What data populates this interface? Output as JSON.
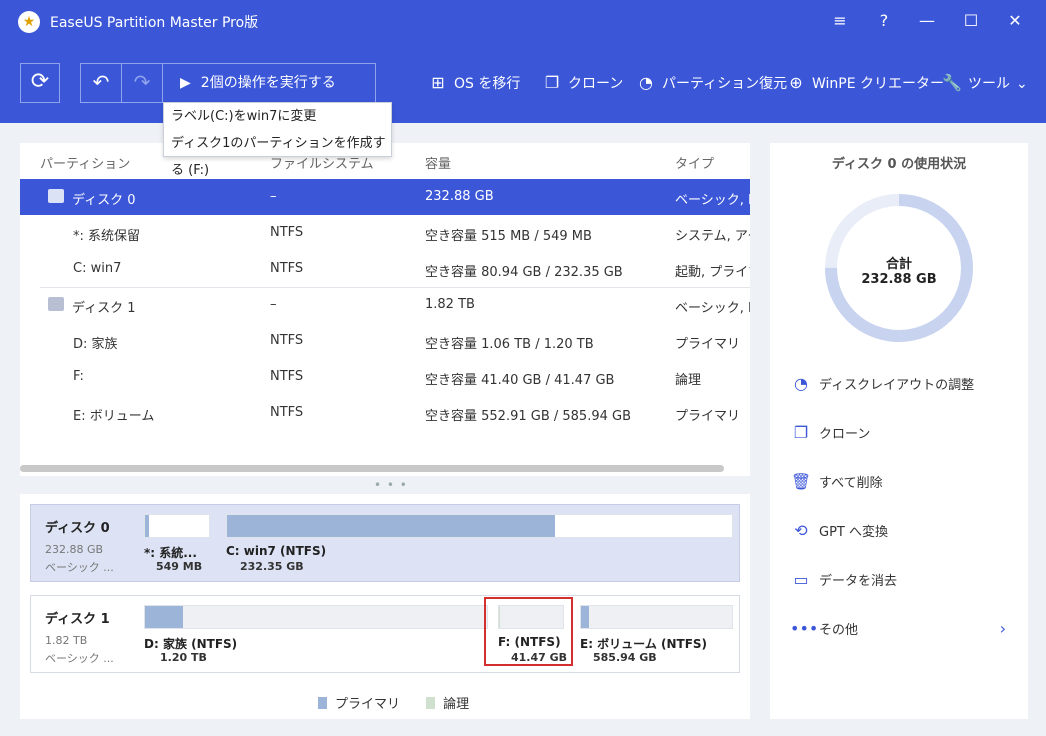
{
  "app": {
    "title": "EaseUS Partition Master Pro版"
  },
  "toolbar": {
    "execute_label": "2個の操作を実行する",
    "tools": [
      {
        "icon": "windows-icon",
        "label": "OS を移行"
      },
      {
        "icon": "clone-icon",
        "label": "クローン"
      },
      {
        "icon": "pie-icon",
        "label": "パーティション復元"
      },
      {
        "icon": "plus-circle-icon",
        "label": "WinPE クリエーター"
      },
      {
        "icon": "wrench-icon",
        "label": "ツール"
      }
    ]
  },
  "pending_ops": [
    "ラベル(C:)をwin7に変更",
    "ディスク1のパーティションを作成する (F:)"
  ],
  "table": {
    "headers": [
      "パーティション",
      "ファイルシステム",
      "容量",
      "タイプ"
    ],
    "rows": [
      {
        "name": "ディスク 0",
        "fs": "–",
        "capacity": "232.88 GB",
        "type": "ベーシック, MB"
      },
      {
        "name": "*: 系统保留",
        "fs": "NTFS",
        "capacity": "空き容量 515 MB / 549 MB",
        "type": "システム, アクテ"
      },
      {
        "name": "C: win7",
        "fs": "NTFS",
        "capacity": "空き容量 80.94 GB / 232.35 GB",
        "type": "起動, プライマ"
      },
      {
        "name": "ディスク 1",
        "fs": "–",
        "capacity": "1.82 TB",
        "type": "ベーシック, MB"
      },
      {
        "name": "D: 家族",
        "fs": "NTFS",
        "capacity": "空き容量 1.06 TB / 1.20 TB",
        "type": "プライマリ"
      },
      {
        "name": "F:",
        "fs": "NTFS",
        "capacity": "空き容量 41.40 GB / 41.47 GB",
        "type": "論理"
      },
      {
        "name": "E: ボリューム",
        "fs": "NTFS",
        "capacity": "空き容量 552.91 GB / 585.94 GB",
        "type": "プライマリ"
      }
    ]
  },
  "disk_map": [
    {
      "name": "ディスク 0",
      "size": "232.88 GB",
      "type": "ベーシック ...",
      "partitions": [
        {
          "name": "*: 系統...",
          "size": "549 MB",
          "used_fraction": 0.06
        },
        {
          "name": "C: win7 (NTFS)",
          "size": "232.35 GB",
          "used_fraction": 0.65
        }
      ]
    },
    {
      "name": "ディスク 1",
      "size": "1.82 TB",
      "type": "ベーシック ...",
      "partitions": [
        {
          "name": "D: 家族 (NTFS)",
          "size": "1.20 TB",
          "used_fraction": 0.12
        },
        {
          "name": "F: (NTFS)",
          "size": "41.47 GB",
          "used_fraction": 0.0
        },
        {
          "name": "E: ボリューム (NTFS)",
          "size": "585.94 GB",
          "used_fraction": 0.05
        }
      ]
    }
  ],
  "legend": {
    "primary": "プライマリ",
    "logical": "論理"
  },
  "colors": {
    "accent": "#3b57d8",
    "primary": "#9cb4d8",
    "logical": "#cfe0cf",
    "highlight": "#d32f2f"
  },
  "usage": {
    "title": "ディスク 0 の使用状況",
    "total_label": "合計",
    "total_value": "232.88 GB"
  },
  "actions": [
    {
      "icon": "pie-chart-icon",
      "label": "ディスクレイアウトの調整"
    },
    {
      "icon": "clone-icon",
      "label": "クローン"
    },
    {
      "icon": "trash-icon",
      "label": "すべて削除"
    },
    {
      "icon": "convert-gpt-icon",
      "label": "GPT へ変換"
    },
    {
      "icon": "eraser-icon",
      "label": "データを消去"
    },
    {
      "icon": "more-icon",
      "label": "その他"
    }
  ]
}
